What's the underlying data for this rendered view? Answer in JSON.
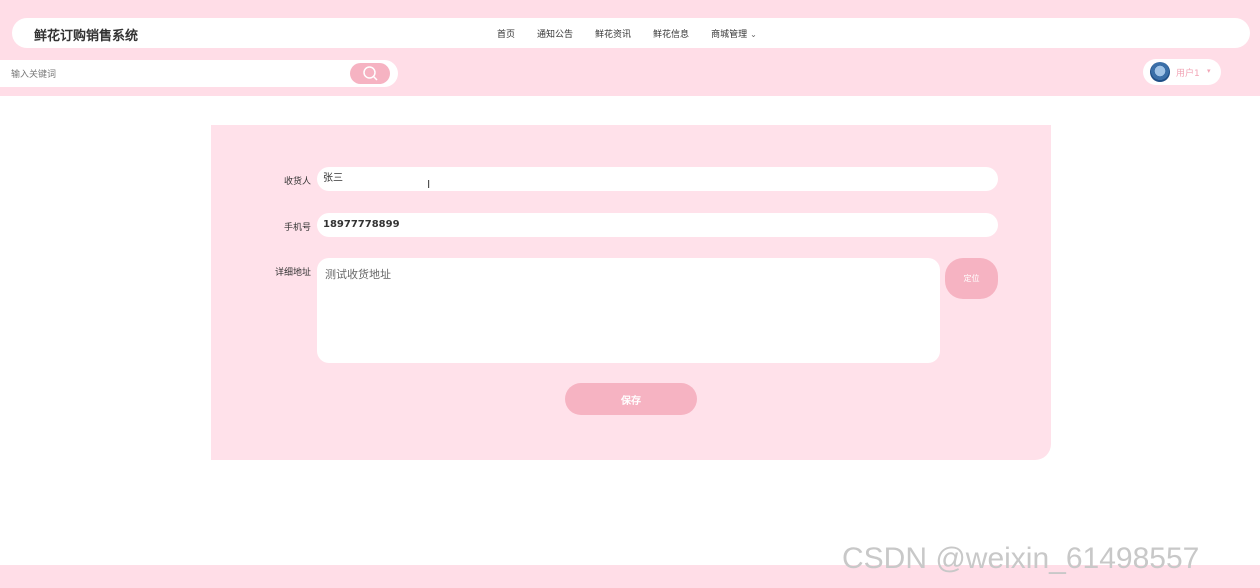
{
  "header": {
    "brand": "鲜花订购销售系统",
    "nav": [
      "首页",
      "通知公告",
      "鲜花资讯",
      "鲜花信息",
      "商城管理"
    ],
    "dropdown_icon": "chevron-down-icon"
  },
  "search": {
    "placeholder": "输入关键词",
    "icon": "search-icon"
  },
  "user": {
    "name": "用户1",
    "avatar_icon": "avatar-globe"
  },
  "form": {
    "receiver_label": "收货人",
    "receiver_value": "张三",
    "phone_label": "手机号",
    "phone_value": "18977778899",
    "address_label": "详细地址",
    "address_value": "测试收货地址",
    "locate_label": "定位",
    "save_label": "保存"
  },
  "watermark": "CSDN @weixin_61498557",
  "colors": {
    "band": "#ffdde7",
    "card": "#ffe1ea",
    "accent": "#f6b3c2"
  }
}
